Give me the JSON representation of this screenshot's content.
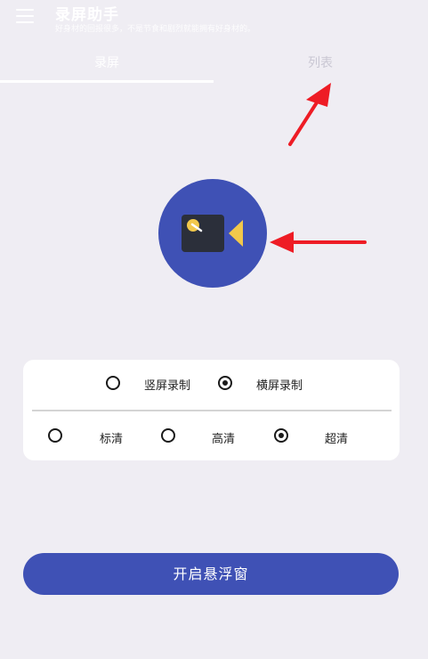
{
  "header": {
    "title": "录屏助手",
    "subtitle": "好身材的回报很多，不是节食和剧烈就能拥有好身材的。"
  },
  "tabs": [
    {
      "label": "录屏",
      "active": true
    },
    {
      "label": "列表",
      "active": false
    }
  ],
  "options": {
    "orientation": [
      {
        "label": "竖屏录制",
        "checked": false
      },
      {
        "label": "横屏录制",
        "checked": true
      }
    ],
    "quality": [
      {
        "label": "标清",
        "checked": false
      },
      {
        "label": "高清",
        "checked": false
      },
      {
        "label": "超清",
        "checked": true
      }
    ]
  },
  "start_button": {
    "label": "开启悬浮窗"
  },
  "colors": {
    "accent": "#3f51b5",
    "background": "#efedf3",
    "card": "#ffffff",
    "camera_body": "#2b2f3a",
    "camera_lens": "#f2c84b",
    "arrow": "#ee1c25"
  },
  "icons": {
    "menu": "hamburger-menu-icon",
    "record": "video-camera-icon"
  }
}
